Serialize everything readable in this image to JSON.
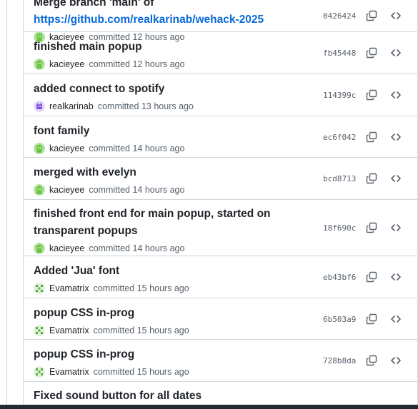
{
  "commits": [
    {
      "title_partial": "Merge branch 'main' of",
      "link": "https://github.com/realkarinab/wehack-2025",
      "author": "kacieyee",
      "time": "committed 12 hours ago",
      "sha": "0426424",
      "avatar": "green-octocat-avatar"
    },
    {
      "title": "finished main popup",
      "author": "kacieyee",
      "time": "committed 12 hours ago",
      "sha": "fb45448",
      "avatar": "green-octocat-avatar"
    },
    {
      "title": "added connect to spotify",
      "author": "realkarinab",
      "time": "committed 13 hours ago",
      "sha": "114399c",
      "avatar": "purple-octocat-avatar"
    },
    {
      "title": "font family",
      "author": "kacieyee",
      "time": "committed 14 hours ago",
      "sha": "ec6f042",
      "avatar": "green-octocat-avatar"
    },
    {
      "title": "merged with evelyn",
      "author": "kacieyee",
      "time": "committed 14 hours ago",
      "sha": "bcd8713",
      "avatar": "green-octocat-avatar"
    },
    {
      "title": "finished front end for main popup, started on transparent popups",
      "author": "kacieyee",
      "time": "committed 14 hours ago",
      "sha": "18f690c",
      "avatar": "green-octocat-avatar"
    },
    {
      "title": "Added 'Jua' font",
      "author": "Evamatrix",
      "time": "committed 15 hours ago",
      "sha": "eb43bf6",
      "avatar": "green-pattern-avatar"
    },
    {
      "title": "popup CSS in-prog",
      "author": "Evamatrix",
      "time": "committed 15 hours ago",
      "sha": "6b503a9",
      "avatar": "green-pattern-avatar"
    },
    {
      "title": "popup CSS in-prog",
      "author": "Evamatrix",
      "time": "committed 15 hours ago",
      "sha": "728b8da",
      "avatar": "green-pattern-avatar"
    },
    {
      "title": "Fixed sound button for all dates"
    }
  ],
  "icons": {
    "copy": "copy-icon",
    "browse": "code-icon"
  },
  "colors": {
    "link": "#0969da",
    "muted": "#57606a",
    "border": "#d0d7de"
  }
}
